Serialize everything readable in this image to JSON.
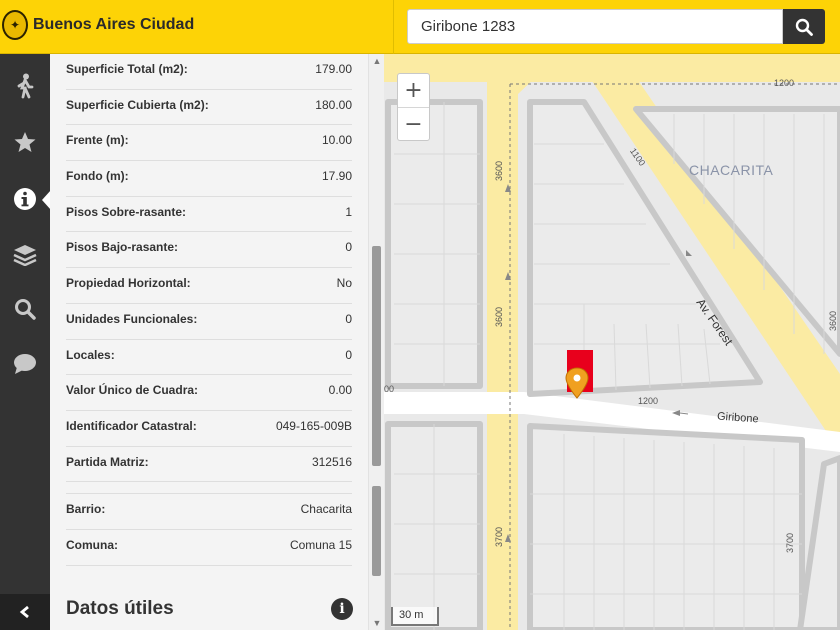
{
  "header": {
    "brand": "Buenos Aires Ciudad",
    "search_value": "Giribone 1283",
    "search_icon": "search-icon"
  },
  "sidebar": {
    "items": [
      {
        "name": "walk",
        "icon": "walk-icon"
      },
      {
        "name": "favorites",
        "icon": "star-icon"
      },
      {
        "name": "info",
        "icon": "info-icon",
        "active": true
      },
      {
        "name": "layers",
        "icon": "layers-icon"
      },
      {
        "name": "search",
        "icon": "search-icon"
      },
      {
        "name": "chat",
        "icon": "chat-icon"
      }
    ],
    "collapse_icon": "chevron-left-icon"
  },
  "panel": {
    "rows": [
      {
        "label": "Superficie Total (m2):",
        "value": "179.00"
      },
      {
        "label": "Superficie Cubierta (m2):",
        "value": "180.00"
      },
      {
        "label": "Frente (m):",
        "value": "10.00"
      },
      {
        "label": "Fondo (m):",
        "value": "17.90"
      },
      {
        "label": "Pisos Sobre-rasante:",
        "value": "1"
      },
      {
        "label": "Pisos Bajo-rasante:",
        "value": "0"
      },
      {
        "label": "Propiedad Horizontal:",
        "value": "No"
      },
      {
        "label": "Unidades Funcionales:",
        "value": "0"
      },
      {
        "label": "Locales:",
        "value": "0"
      },
      {
        "label": "Valor Único de Cuadra:",
        "value": "0.00"
      },
      {
        "label": "Identificador Catastral:",
        "value": "049-165-009B"
      },
      {
        "label": "Partida Matriz:",
        "value": "312516"
      }
    ],
    "rows2": [
      {
        "label": "Barrio:",
        "value": "Chacarita"
      },
      {
        "label": "Comuna:",
        "value": "Comuna 15"
      }
    ],
    "datos_title": "Datos útiles",
    "datos_icon": "info-icon"
  },
  "map": {
    "neighborhood": "CHACARITA",
    "streets": {
      "av_forest": "Av. Forest",
      "giribone": "Giribone"
    },
    "numbers": {
      "top_1200": "1200",
      "giribone_1200": "1200",
      "v3600_a": "3600",
      "v3600_b": "3600",
      "v3700": "3700",
      "forest_1100": "1100",
      "right_3600": "3600",
      "right_3700": "3700",
      "left_00": "00"
    },
    "zoom_in": "+",
    "zoom_out": "−",
    "scale": "30 m",
    "marker_icon": "map-pin-icon"
  },
  "colors": {
    "header_yellow": "#fdd306",
    "sidebar_dark": "#333333",
    "road_yellow": "#fbeba3",
    "marker_red": "#e8001c",
    "marker_orange": "#f0a020"
  }
}
